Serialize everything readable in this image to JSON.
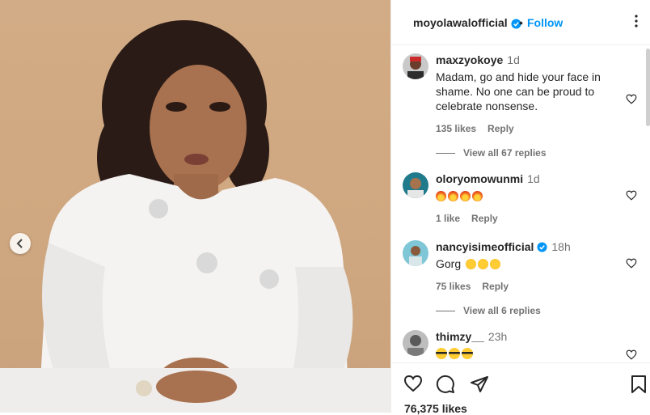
{
  "post": {
    "username": "moyolawalofficial",
    "separator": "•",
    "follow_label": "Follow",
    "likes_label": "76,375 likes"
  },
  "comments": [
    {
      "username": "maxzyokoye",
      "time": "1d",
      "text": "Madam, go and hide your face in shame. No one can be proud to celebrate nonsense.",
      "likes": "135 likes",
      "reply": "Reply",
      "view_replies": "View all 67 replies"
    },
    {
      "username": "oloryomowunmi",
      "time": "1d",
      "emojis": [
        "fire",
        "fire",
        "fire",
        "fire"
      ],
      "likes": "1 like",
      "reply": "Reply"
    },
    {
      "username": "nancyisimeofficial",
      "verified": true,
      "time": "18h",
      "text": "Gorg",
      "emojis": [
        "star-struck",
        "star-struck",
        "star-struck"
      ],
      "likes": "75 likes",
      "reply": "Reply",
      "view_replies": "View all 6 replies"
    },
    {
      "username": "thimzy__",
      "time": "23h",
      "emojis": [
        "sunglasses-face",
        "sunglasses-face",
        "sunglasses-face"
      ]
    }
  ],
  "icons": [
    "verified-badge-icon",
    "more-icon",
    "chevron-left-icon",
    "heart-icon",
    "comment-icon",
    "share-icon",
    "bookmark-icon"
  ],
  "colors": {
    "link": "#0095f6",
    "muted": "#737373",
    "text": "#262626",
    "verified": "#0095f6"
  }
}
